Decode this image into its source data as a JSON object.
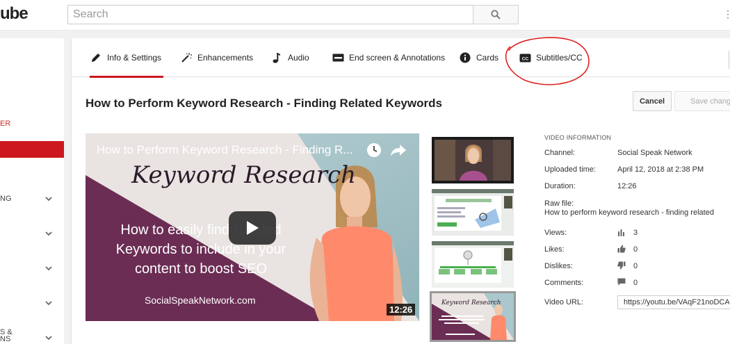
{
  "header": {
    "logo_text": "ube",
    "search_placeholder": "Search",
    "overflow_dots": "⋮"
  },
  "sidebar": {
    "red_label": "ER",
    "items": [
      {
        "label": "NG"
      },
      {
        "label": ""
      },
      {
        "label": ""
      },
      {
        "label": ""
      },
      {
        "label": "S &\nNS"
      }
    ]
  },
  "tabs": [
    {
      "label": "Info & Settings",
      "icon": "pencil-icon",
      "active": true
    },
    {
      "label": "Enhancements",
      "icon": "magic-wand-icon",
      "active": false
    },
    {
      "label": "Audio",
      "icon": "music-note-icon",
      "active": false
    },
    {
      "label": "End screen & Annotations",
      "icon": "end-screen-icon",
      "active": false
    },
    {
      "label": "Cards",
      "icon": "info-icon",
      "active": false
    },
    {
      "label": "Subtitles/CC",
      "icon": "cc-icon",
      "active": false
    }
  ],
  "video": {
    "title": "How to Perform Keyword Research - Finding Related Keywords",
    "player_title": "How to Perform Keyword Research - Finding R...",
    "overlay_script": "Keyword Research",
    "overlay_lines": [
      "How to easily find Related",
      "Keywords to include in your",
      "content to boost SEO"
    ],
    "overlay_site": "SocialSpeakNetwork.com",
    "duration": "12:26"
  },
  "actions": {
    "cancel_label": "Cancel",
    "save_label": "Save changes"
  },
  "info": {
    "heading": "VIDEO INFORMATION",
    "channel_label": "Channel:",
    "channel_value": "Social Speak Network",
    "uploaded_label": "Uploaded time:",
    "uploaded_value": "April 12, 2018 at 2:38 PM",
    "duration_label": "Duration:",
    "duration_value": "12:26",
    "raw_label": "Raw file:",
    "raw_value": "How to perform keyword research - finding related",
    "views_label": "Views:",
    "views_value": "3",
    "likes_label": "Likes:",
    "likes_value": "0",
    "dislikes_label": "Dislikes:",
    "dislikes_value": "0",
    "comments_label": "Comments:",
    "comments_value": "0",
    "url_label": "Video URL:",
    "url_value": "https://youtu.be/VAqF21noDCA"
  },
  "colors": {
    "accent_red": "#cc181e",
    "annotation_red": "#e02020",
    "overlay_plum": "#6b2d54"
  }
}
